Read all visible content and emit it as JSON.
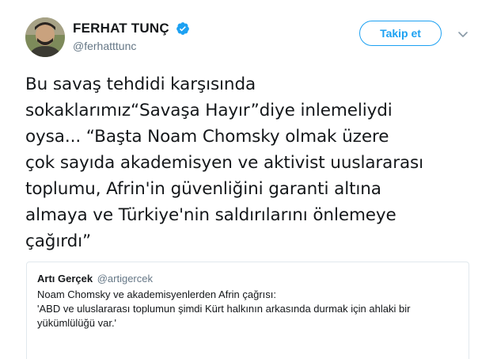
{
  "author": {
    "display_name": "FERHAT TUNÇ",
    "screen_name": "@ferhatttunc",
    "verified": true,
    "avatar_icon": "user-avatar-photo"
  },
  "follow_button_label": "Takip et",
  "menu_icon": "chevron-down-icon",
  "tweet": {
    "lines": [
      "Bu savaş tehdidi karşısında",
      "sokaklarımız“Savaşa Hayır”diye inlemeliydi",
      "oysa... “Başta Noam Chomsky olmak üzere",
      "çok sayıda akademisyen ve aktivist uuslararası",
      "toplumu, Afrin'in güvenliğini garanti altına",
      "almaya ve Türkiye'nin saldırılarını önlemeye",
      "çağırdı”"
    ]
  },
  "quoted_tweet": {
    "display_name": "Artı Gerçek",
    "screen_name": "@artigercek",
    "lines": [
      "Noam Chomsky ve akademisyenlerden Afrin çağrısı:",
      "'ABD ve uluslararası toplumun şimdi Kürt halkının arkasında durmak için ahlaki bir",
      "yükümlülüğü var.'"
    ]
  },
  "colors": {
    "accent": "#1da1f2",
    "text": "#14171a",
    "secondary_text": "#657786",
    "border": "#e1e8ed"
  }
}
